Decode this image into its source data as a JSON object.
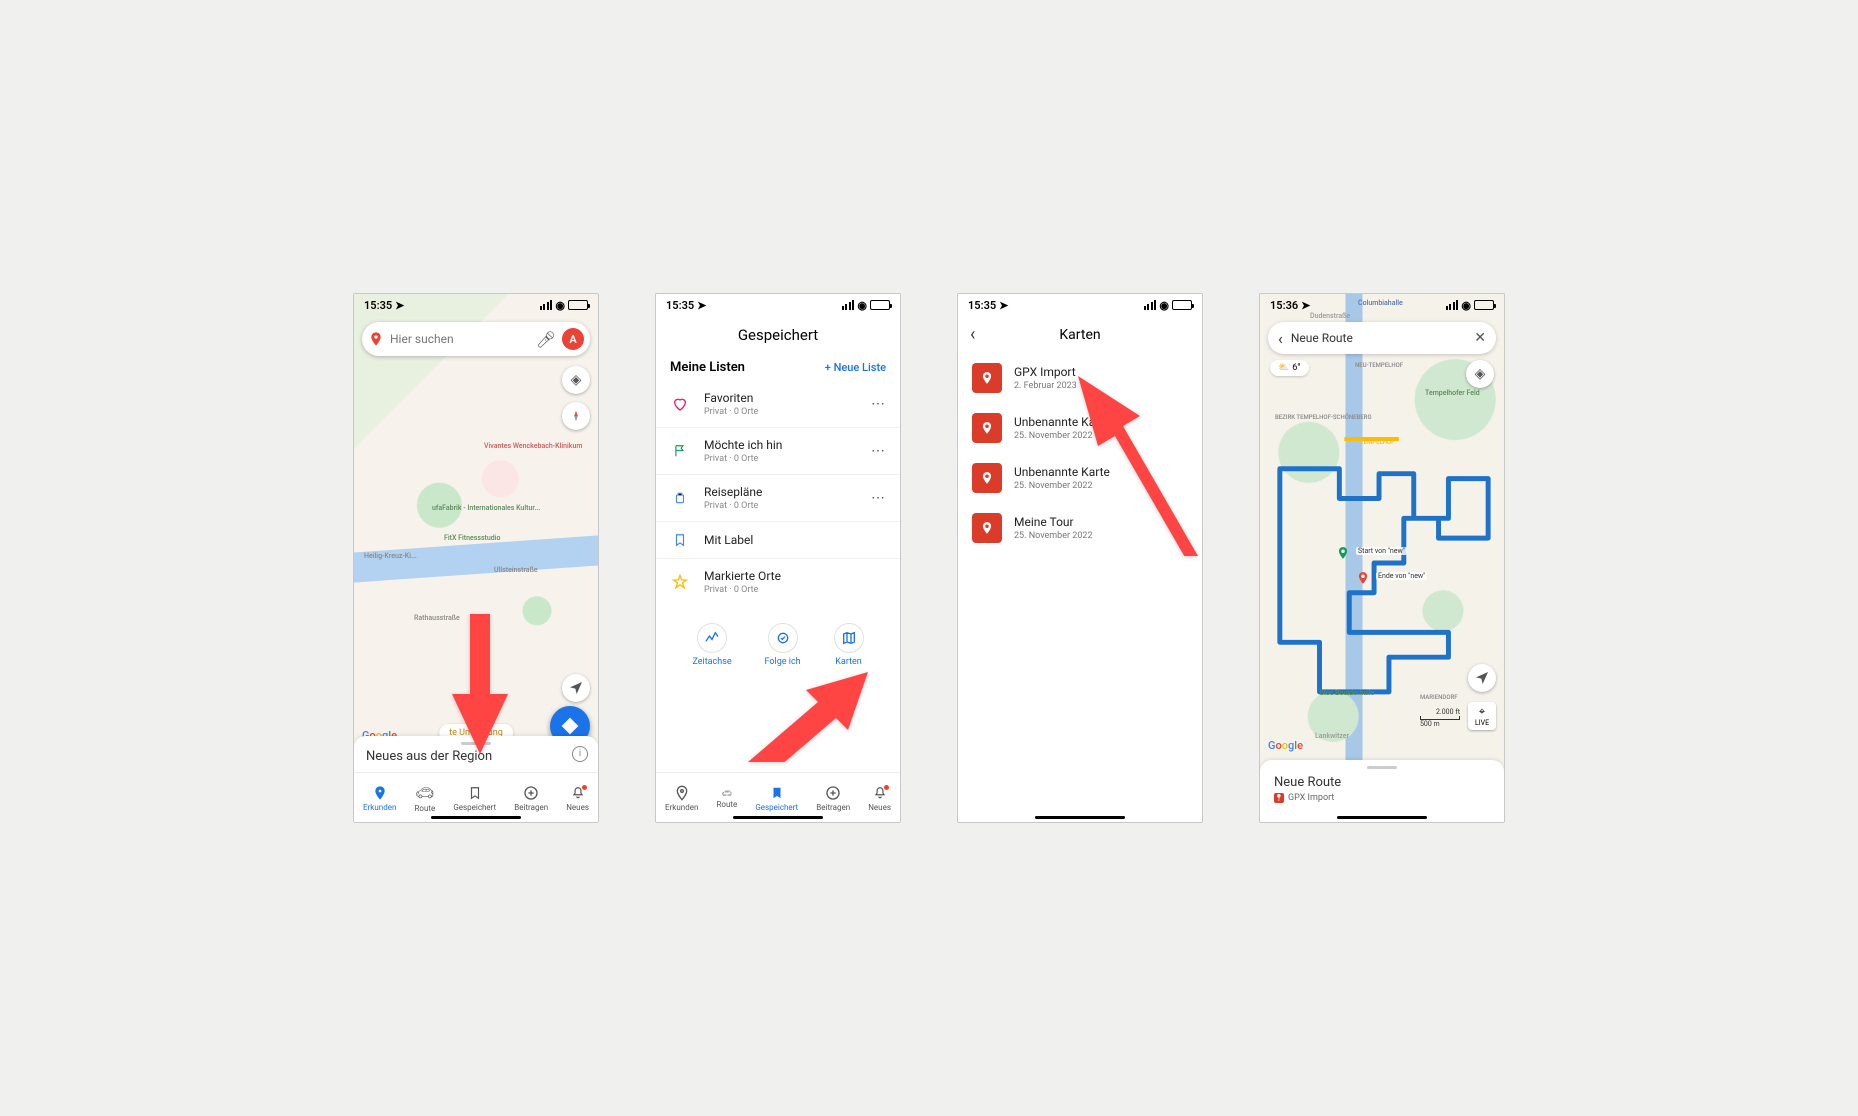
{
  "phone1": {
    "status_time": "15:35",
    "search_placeholder": "Hier suchen",
    "avatar_letter": "A",
    "umgebung_label": "te Umgebung",
    "sheet_title": "Neues aus der Region",
    "google_logo": "Google",
    "map_labels": {
      "hospital": "Vivantes Wenckebach-Klinikum",
      "culture": "ufaFabrik - Internationales Kultur...",
      "fitness": "FitX Fitnessstudio",
      "church": "Heilig-Kreuz-Ki...",
      "street": "Ullsteinstraße",
      "street2": "Rathausstraße"
    },
    "tabs": [
      {
        "label": "Erkunden",
        "active": true
      },
      {
        "label": "Route",
        "active": false
      },
      {
        "label": "Gespeichert",
        "active": false
      },
      {
        "label": "Beitragen",
        "active": false
      },
      {
        "label": "Neues",
        "active": false
      }
    ]
  },
  "phone2": {
    "status_time": "15:35",
    "page_title": "Gespeichert",
    "section_title": "Meine Listen",
    "new_list_label": "Neue Liste",
    "lists": [
      {
        "name": "Favoriten",
        "sub": "Privat · 0 Orte",
        "icon": "heart",
        "color": "#e91e63"
      },
      {
        "name": "Möchte ich hin",
        "sub": "Privat · 0 Orte",
        "icon": "flag",
        "color": "#0f9d58"
      },
      {
        "name": "Reisepläne",
        "sub": "Privat · 0 Orte",
        "icon": "luggage",
        "color": "#4285f4"
      },
      {
        "name": "Mit Label",
        "sub": "",
        "icon": "bookmark",
        "color": "#4285f4"
      },
      {
        "name": "Markierte Orte",
        "sub": "Privat · 0 Orte",
        "icon": "star",
        "color": "#fbbc05"
      }
    ],
    "actions": [
      {
        "label": "Zeitachse",
        "icon": "timeline"
      },
      {
        "label": "Folge ich",
        "icon": "follow"
      },
      {
        "label": "Karten",
        "icon": "map"
      }
    ],
    "tabs": [
      {
        "label": "Erkunden",
        "active": false
      },
      {
        "label": "Route",
        "active": false
      },
      {
        "label": "Gespeichert",
        "active": true
      },
      {
        "label": "Beitragen",
        "active": false
      },
      {
        "label": "Neues",
        "active": false
      }
    ]
  },
  "phone3": {
    "status_time": "15:35",
    "page_title": "Karten",
    "maps": [
      {
        "name": "GPX Import",
        "date": "2. Februar 2023"
      },
      {
        "name": "Unbenannte Karte",
        "date": "25. November 2022"
      },
      {
        "name": "Unbenannte Karte",
        "date": "25. November 2022"
      },
      {
        "name": "Meine Tour",
        "date": "25. November 2022"
      }
    ]
  },
  "phone4": {
    "status_time": "15:36",
    "route_name": "Neue Route",
    "weather_temp": "6°",
    "live_label": "LIVE",
    "sheet_title": "Neue Route",
    "sheet_sub": "GPX Import",
    "google_logo": "Google",
    "marker_start": "Start von \"new\"",
    "marker_end": "Ende von \"new\"",
    "scale_ft": "2.000 ft",
    "scale_m": "500 m",
    "map_labels": {
      "columbiahalle": "Columbiahalle",
      "dudenstr": "Dudenstraße",
      "neu_tempelhof": "NEU-TEMPELHOF",
      "tempelhofer": "Tempelhofer Feld",
      "bezirk": "BEZIRK TEMPELHOF-SCHÖNEBERG",
      "tempelhof_ring": "TEMPELHOF",
      "mariendorf": "MARIENDORF",
      "boulder": "bloc Boulderhalle",
      "lankwitzer": "Lankwitzer"
    }
  }
}
